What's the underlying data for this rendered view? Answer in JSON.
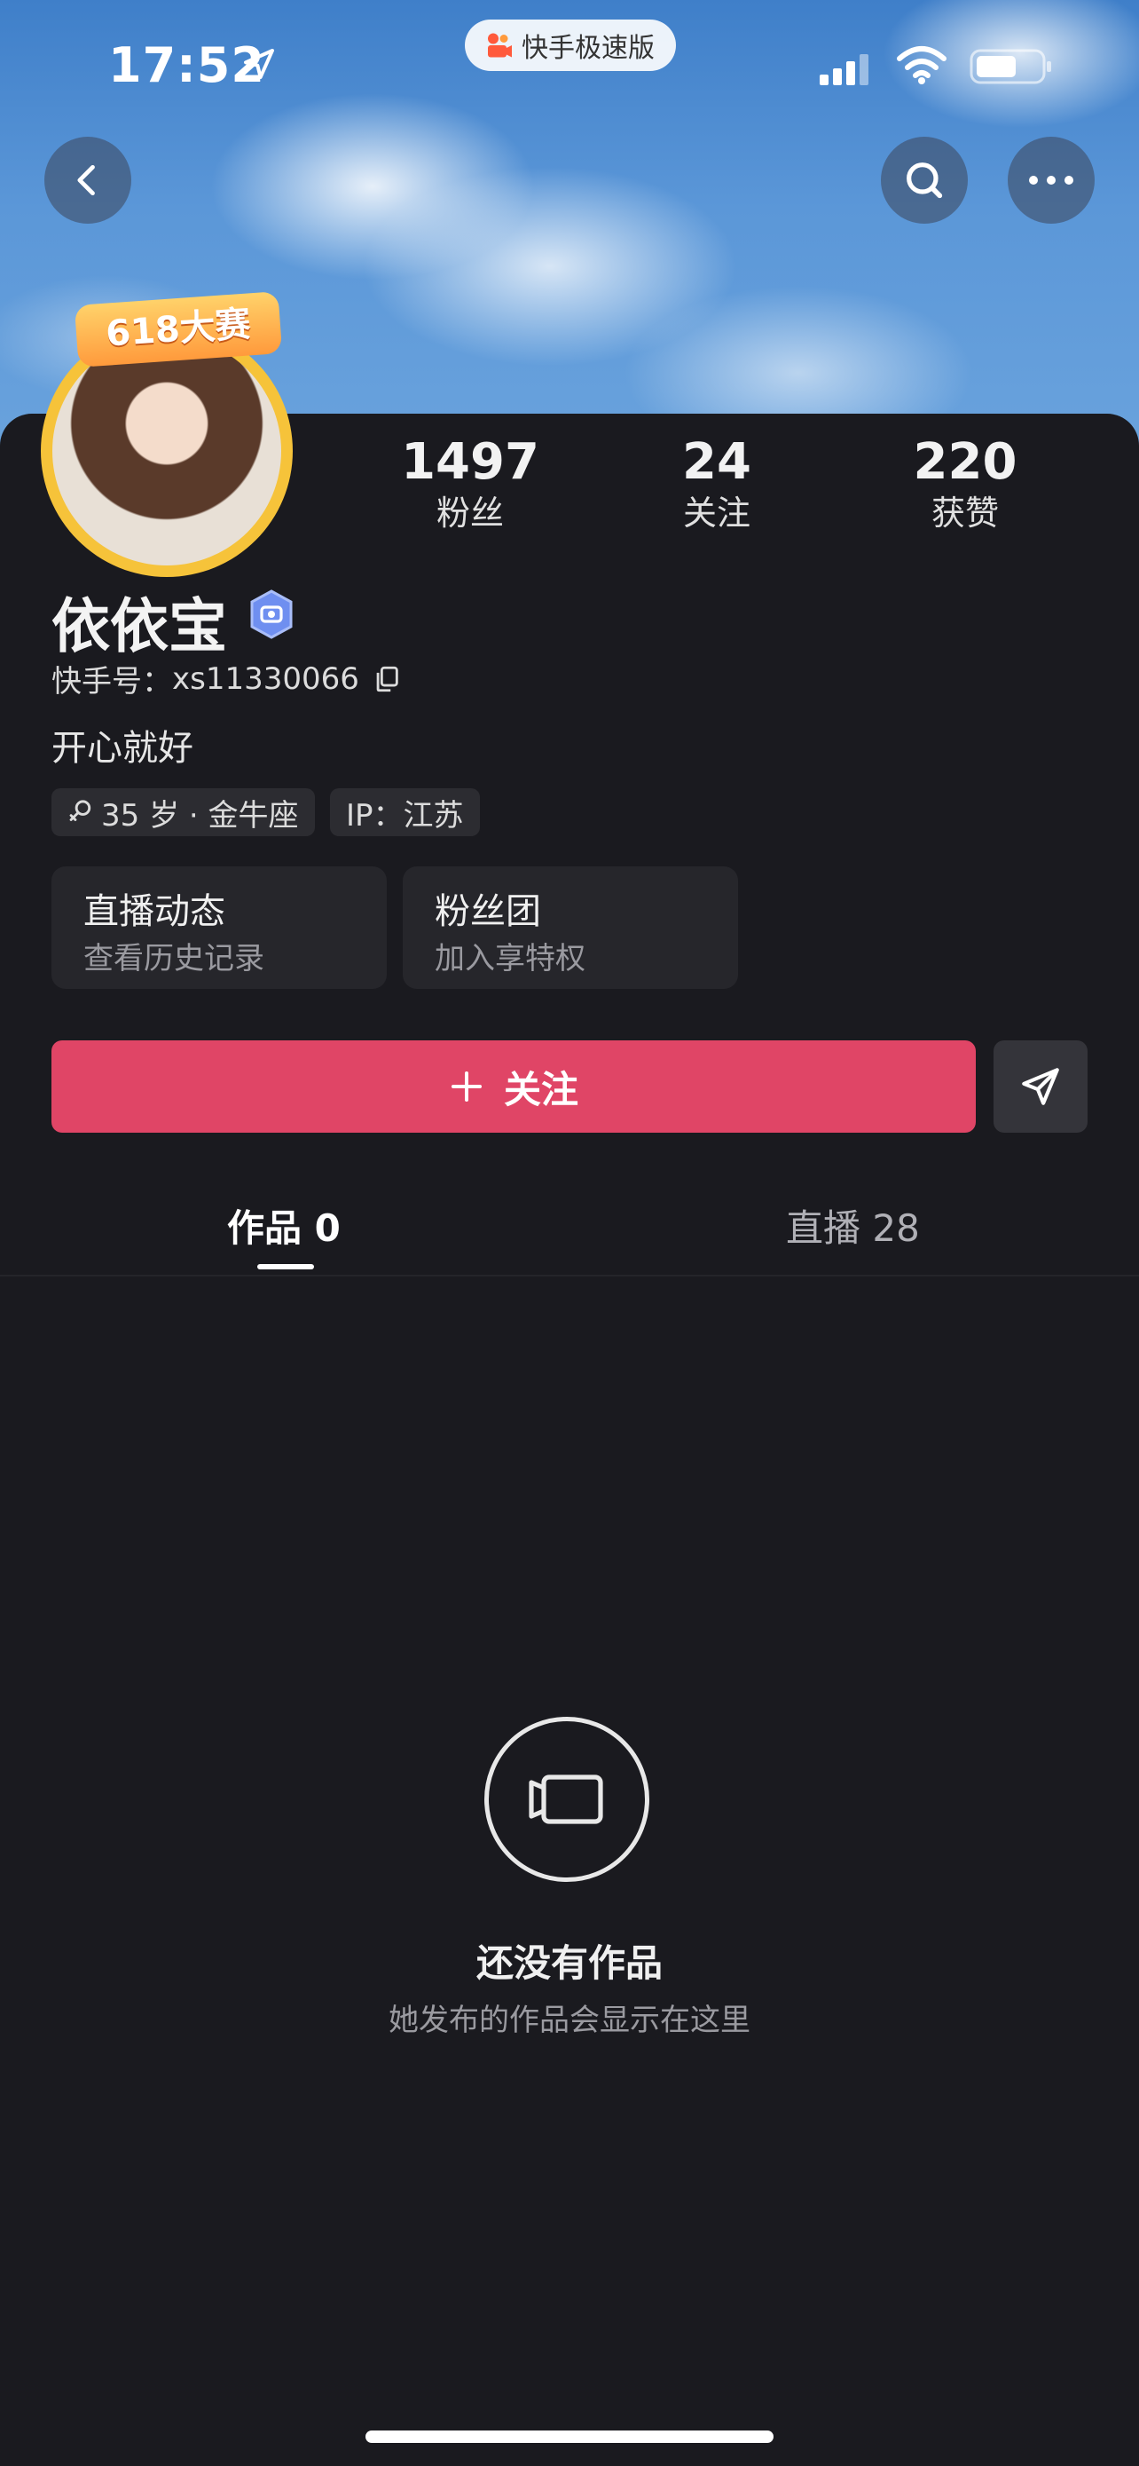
{
  "status_bar": {
    "time": "17:52",
    "app_pill": "快手极速版"
  },
  "profile": {
    "badge_text": "618大赛",
    "name": "依依宝",
    "kuaishou_id_label": "快手号：",
    "kuaishou_id": "xs11330066",
    "bio": "开心就好",
    "tags": {
      "age": "35 岁 · 金牛座",
      "ip": "IP：江苏"
    }
  },
  "stats": [
    {
      "value": "1497",
      "label": "粉丝"
    },
    {
      "value": "24",
      "label": "关注"
    },
    {
      "value": "220",
      "label": "获赞"
    }
  ],
  "entries": {
    "live": {
      "title": "直播动态",
      "subtitle": "查看历史记录"
    },
    "fans": {
      "title": "粉丝团",
      "subtitle": "加入享特权"
    }
  },
  "actions": {
    "follow_label": "关注"
  },
  "tabs": [
    {
      "label": "作品 0",
      "active": true
    },
    {
      "label": "直播 28",
      "active": false
    }
  ],
  "empty_state": {
    "title": "还没有作品",
    "subtitle": "她发布的作品会显示在这里"
  },
  "colors": {
    "accent": "#e04566",
    "background": "#1a1a1f",
    "avatar_ring": "#f6c33a"
  }
}
